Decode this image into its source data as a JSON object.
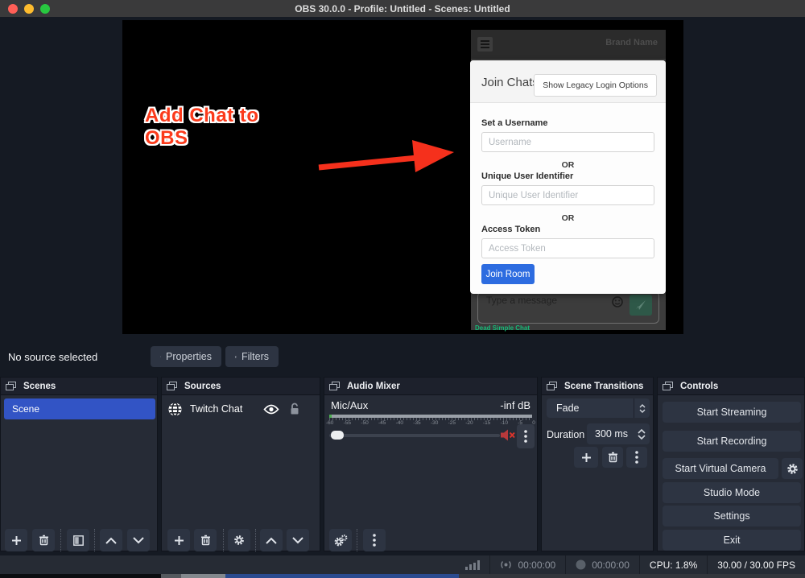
{
  "window": {
    "title": "OBS 30.0.0 - Profile: Untitled - Scenes: Untitled"
  },
  "preview": {
    "annotation_line1": "Add Chat to",
    "annotation_line2": "OBS"
  },
  "chat_widget": {
    "brand": "Brand Name",
    "modal": {
      "title": "Join Chats",
      "legacy_button": "Show Legacy Login Options",
      "username_label": "Set a Username",
      "username_placeholder": "Username",
      "or_1": "OR",
      "uuid_label": "Unique User Identifier",
      "uuid_placeholder": "Unique User Identifier",
      "or_2": "OR",
      "token_label": "Access Token",
      "token_placeholder": "Access Token",
      "join_button": "Join Room"
    },
    "message_placeholder": "Type a message",
    "footer_brand": "Dead Simple Chat"
  },
  "source_toolbar": {
    "status": "No source selected",
    "properties_button": "Properties",
    "filters_button": "Filters"
  },
  "panels": {
    "scenes": {
      "title": "Scenes",
      "items": [
        {
          "label": "Scene"
        }
      ]
    },
    "sources": {
      "title": "Sources",
      "items": [
        {
          "label": "Twitch Chat"
        }
      ]
    },
    "audio_mixer": {
      "title": "Audio Mixer",
      "channel": "Mic/Aux",
      "level": "-inf dB",
      "ticks": [
        "-60",
        "-55",
        "-50",
        "-45",
        "-40",
        "-35",
        "-30",
        "-25",
        "-20",
        "-15",
        "-10",
        "-5",
        "0"
      ]
    },
    "transitions": {
      "title": "Scene Transitions",
      "selected_transition": "Fade",
      "duration_label": "Duration",
      "duration_value": "300 ms"
    },
    "controls": {
      "title": "Controls",
      "buttons": [
        "Start Streaming",
        "Start Recording",
        "Start Virtual Camera",
        "Studio Mode",
        "Settings",
        "Exit"
      ]
    }
  },
  "statusbar": {
    "stream_time": "00:00:00",
    "record_time": "00:00:00",
    "cpu": "CPU: 1.8%",
    "fps": "30.00 / 30.00 FPS"
  },
  "colors": {
    "selection_blue": "#3254c5",
    "join_blue": "#2d6ce0",
    "annotation_red": "#fb3a1b",
    "brand_green": "#17b877",
    "mute_red": "#c43b3b"
  }
}
